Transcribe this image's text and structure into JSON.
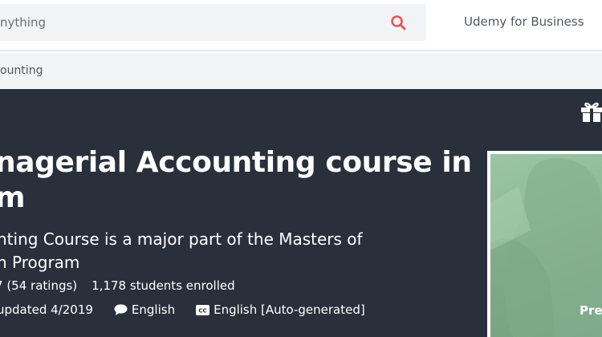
{
  "header": {
    "search_text": "nything",
    "business_link": "Udemy for Business"
  },
  "breadcrumb": {
    "label": "ounting"
  },
  "course": {
    "title_lines": [
      "nagerial Accounting course in",
      "m"
    ],
    "subtitle_lines": [
      "nting Course is a major part of the Masters of",
      "n Program"
    ],
    "ratings": "(54 ratings)",
    "ratings_prefix": "7",
    "students": "1,178 students enrolled",
    "updated": "updated 4/2019",
    "language": "English",
    "captions": "English [Auto-generated]"
  },
  "preview": {
    "label": "Pre"
  },
  "colors": {
    "hero_bg": "#29303b",
    "search_icon": "#ec5252",
    "topbar_bg": "#ffffff",
    "crumb_bg": "#f2f3f5"
  },
  "icons": [
    "search-icon",
    "gift-icon",
    "speech-bubble-icon",
    "closed-captions-icon"
  ]
}
